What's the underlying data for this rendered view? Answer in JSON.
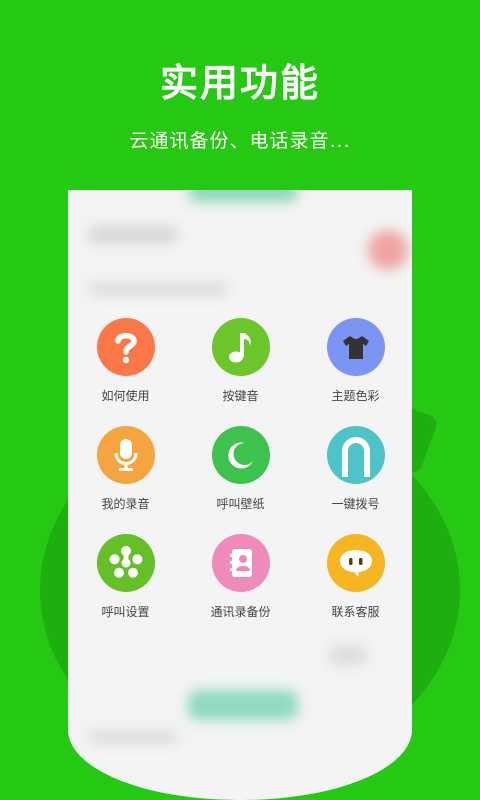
{
  "title": "实用功能",
  "subtitle": "云通讯备份、电话录音...",
  "colors": {
    "background": "#25c812",
    "screen": "#f3f4f3"
  },
  "features": [
    {
      "label": "如何使用",
      "icon": "question-icon",
      "color": "#fb7748"
    },
    {
      "label": "按键音",
      "icon": "music-note-icon",
      "color": "#6cc62a"
    },
    {
      "label": "主题色彩",
      "icon": "tshirt-icon",
      "color": "#7c95f5"
    },
    {
      "label": "我的录音",
      "icon": "microphone-icon",
      "color": "#f5a43f"
    },
    {
      "label": "呼叫壁纸",
      "icon": "moon-icon",
      "color": "#3dc24e"
    },
    {
      "label": "一键拨号",
      "icon": "arch-icon",
      "color": "#4ec4c9"
    },
    {
      "label": "呼叫设置",
      "icon": "asterisk-icon",
      "color": "#64c026"
    },
    {
      "label": "通讯录备份",
      "icon": "address-book-icon",
      "color": "#ef8bbb"
    },
    {
      "label": "联系客服",
      "icon": "chat-bubble-icon",
      "color": "#f6b623"
    }
  ]
}
